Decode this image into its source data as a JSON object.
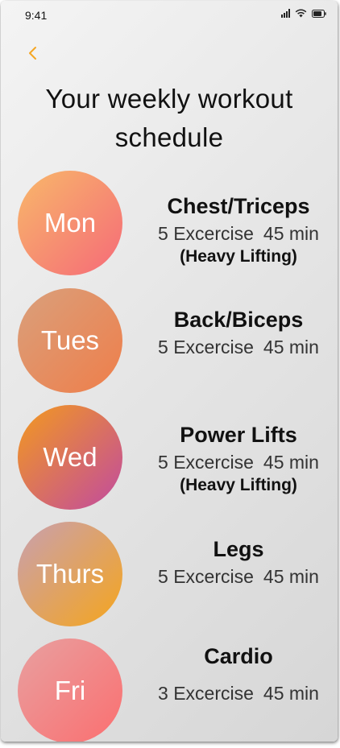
{
  "status_bar": {
    "time": "9:41"
  },
  "header": {
    "title": "Your weekly workout\nschedule"
  },
  "colors": {
    "back_arrow": "#f5a623",
    "text_primary": "#111111"
  },
  "days": [
    {
      "day": "Mon",
      "name": "Chest/Triceps",
      "exercises": "5 Excercise",
      "duration": "45 min",
      "note": "(Heavy Lifting)",
      "gradient": [
        "#f8b86a",
        "#f56a78"
      ]
    },
    {
      "day": "Tues",
      "name": "Back/Biceps",
      "exercises": "5 Excercise",
      "duration": "45 min",
      "note": "",
      "gradient": [
        "#d9a07c",
        "#ef7e4a"
      ]
    },
    {
      "day": "Wed",
      "name": "Power Lifts",
      "exercises": "5 Excercise",
      "duration": "45 min",
      "note": "(Heavy Lifting)",
      "gradient": [
        "#f39a1e",
        "#c14aa0"
      ]
    },
    {
      "day": "Thurs",
      "name": "Legs",
      "exercises": "5 Excercise",
      "duration": "45 min",
      "note": "",
      "gradient": [
        "#c8a0b0",
        "#f5a51d"
      ]
    },
    {
      "day": "Fri",
      "name": "Cardio",
      "exercises": "3 Excercise",
      "duration": "45 min",
      "note": "",
      "gradient": [
        "#e8a0a0",
        "#fb6f70"
      ]
    }
  ]
}
